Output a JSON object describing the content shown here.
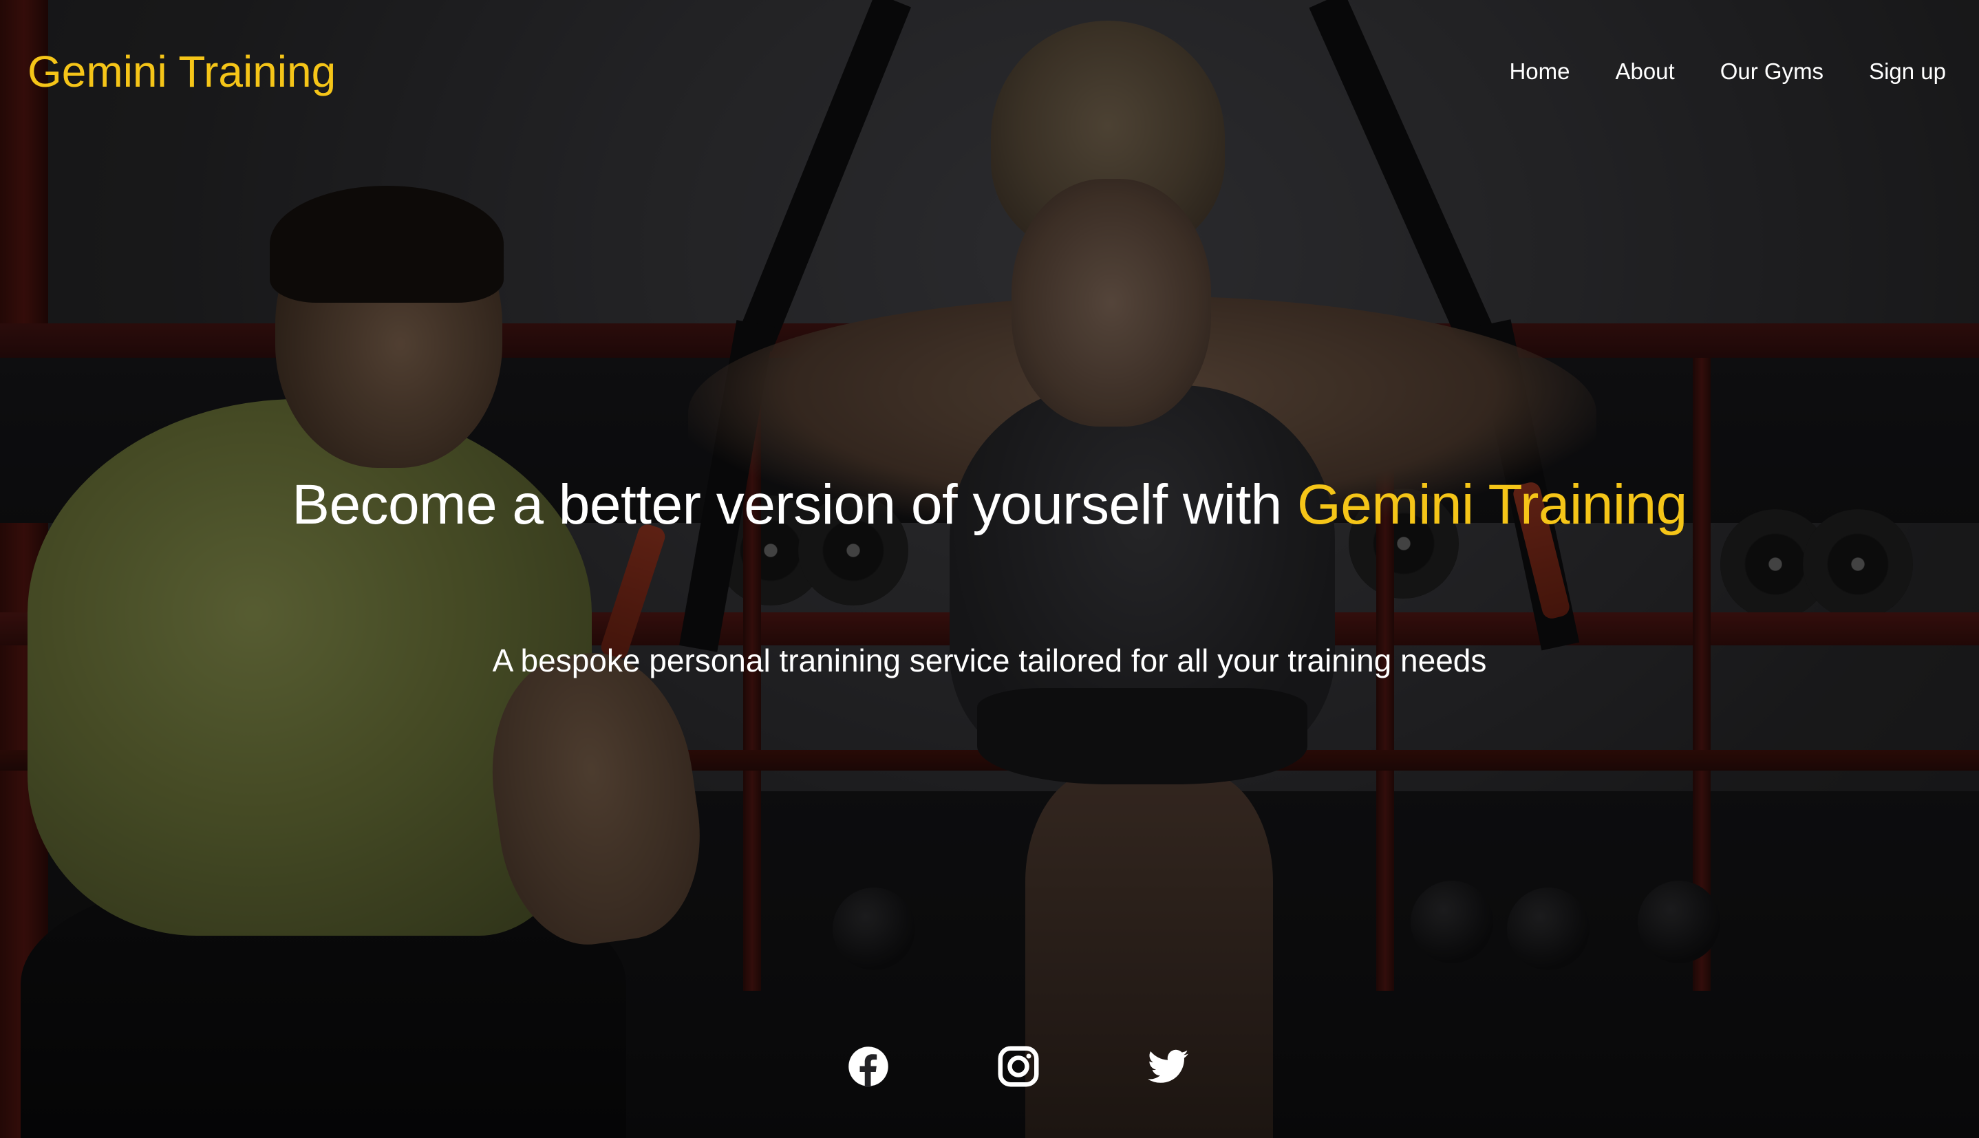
{
  "brand": {
    "name": "Gemini Training",
    "color": "#f5c518"
  },
  "nav": {
    "items": [
      {
        "label": "Home"
      },
      {
        "label": "About"
      },
      {
        "label": "Our Gyms"
      },
      {
        "label": "Sign up"
      }
    ]
  },
  "hero": {
    "headline_prefix": "Become a better version of yourself with ",
    "headline_highlight": "Gemini Training",
    "subheadline": "A bespoke personal tranining service tailored for all your training needs"
  },
  "socials": [
    {
      "icon": "facebook-icon"
    },
    {
      "icon": "instagram-icon"
    },
    {
      "icon": "twitter-icon"
    }
  ],
  "colors": {
    "accent": "#f5c518",
    "text": "#ffffff"
  }
}
